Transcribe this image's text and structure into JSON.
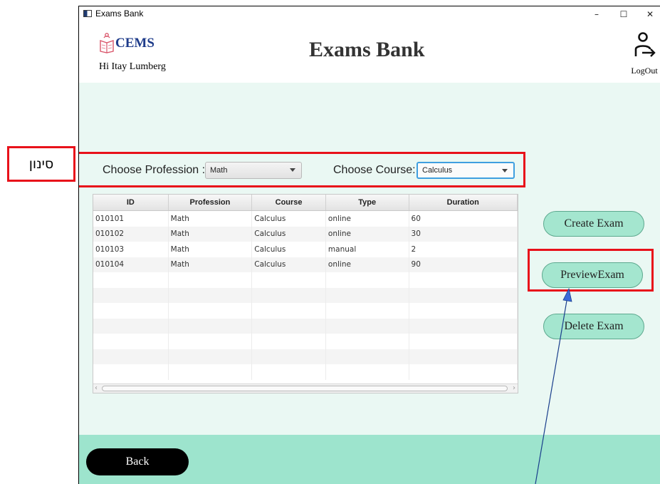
{
  "annotation": {
    "label": "סינון"
  },
  "window": {
    "title": "Exams Bank",
    "controls": {
      "minimize": "–",
      "maximize": "☐",
      "close": "✕"
    }
  },
  "header": {
    "logo_text": "CEMS",
    "greeting": "Hi Itay Lumberg",
    "title": "Exams Bank",
    "logout_label": "LogOut"
  },
  "filters": {
    "profession_label": "Choose Profession :",
    "profession_value": "Math",
    "course_label": "Choose Course:",
    "course_value": "Calculus"
  },
  "table": {
    "columns": [
      "ID",
      "Profession",
      "Course",
      "Type",
      "Duration"
    ],
    "rows": [
      [
        "010101",
        "Math",
        "Calculus",
        "online",
        "60"
      ],
      [
        "010102",
        "Math",
        "Calculus",
        "online",
        "30"
      ],
      [
        "010103",
        "Math",
        "Calculus",
        "manual",
        "2"
      ],
      [
        "010104",
        "Math",
        "Calculus",
        "online",
        "90"
      ]
    ]
  },
  "actions": {
    "create": "Create Exam",
    "preview": "PreviewExam",
    "delete": "Delete Exam"
  },
  "footer": {
    "back": "Back"
  },
  "colors": {
    "annotation_red": "#e8111a",
    "main_bg": "#eaf8f3",
    "footer_bg": "#9de4cd",
    "pill_bg": "#a4e6cf",
    "logo_blue": "#1e3b8a",
    "arrow_blue": "#3b6bd8"
  }
}
